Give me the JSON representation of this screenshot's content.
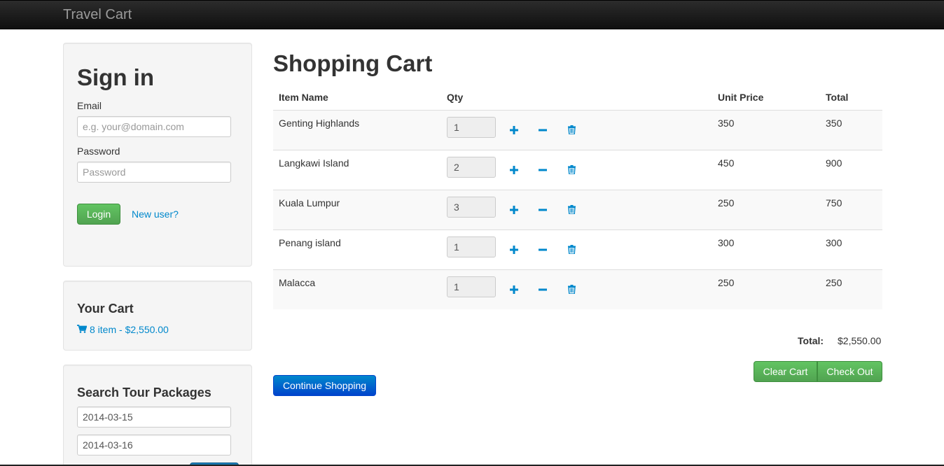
{
  "navbar": {
    "brand": "Travel Cart"
  },
  "signin": {
    "title": "Sign in",
    "email_label": "Email",
    "email_placeholder": "e.g. your@domain.com",
    "password_label": "Password",
    "password_placeholder": "Password",
    "login_button": "Login",
    "new_user_link": "New user?"
  },
  "your_cart": {
    "title": "Your Cart",
    "summary": "8 item - $2,550.00",
    "icon": "shopping-cart-icon"
  },
  "search_tours": {
    "title": "Search Tour Packages",
    "date_from": "2014-03-15",
    "date_to": "2014-03-16"
  },
  "cart": {
    "title": "Shopping Cart",
    "headers": {
      "item_name": "Item Name",
      "qty": "Qty",
      "unit_price": "Unit Price",
      "total": "Total"
    },
    "items": [
      {
        "name": "Genting Highlands",
        "qty": "1",
        "unit_price": "350",
        "total": "350"
      },
      {
        "name": "Langkawi Island",
        "qty": "2",
        "unit_price": "450",
        "total": "900"
      },
      {
        "name": "Kuala Lumpur",
        "qty": "3",
        "unit_price": "250",
        "total": "750"
      },
      {
        "name": "Penang island",
        "qty": "1",
        "unit_price": "300",
        "total": "300"
      },
      {
        "name": "Malacca",
        "qty": "1",
        "unit_price": "250",
        "total": "250"
      }
    ],
    "total_label": "Total:",
    "total_value": "$2,550.00",
    "clear_button": "Clear Cart",
    "checkout_button": "Check Out",
    "continue_button": "Continue Shopping"
  },
  "colors": {
    "link": "#0088cc",
    "success": "#51a351",
    "primary": "#0044cc",
    "navbar": "#1b1b1b"
  }
}
